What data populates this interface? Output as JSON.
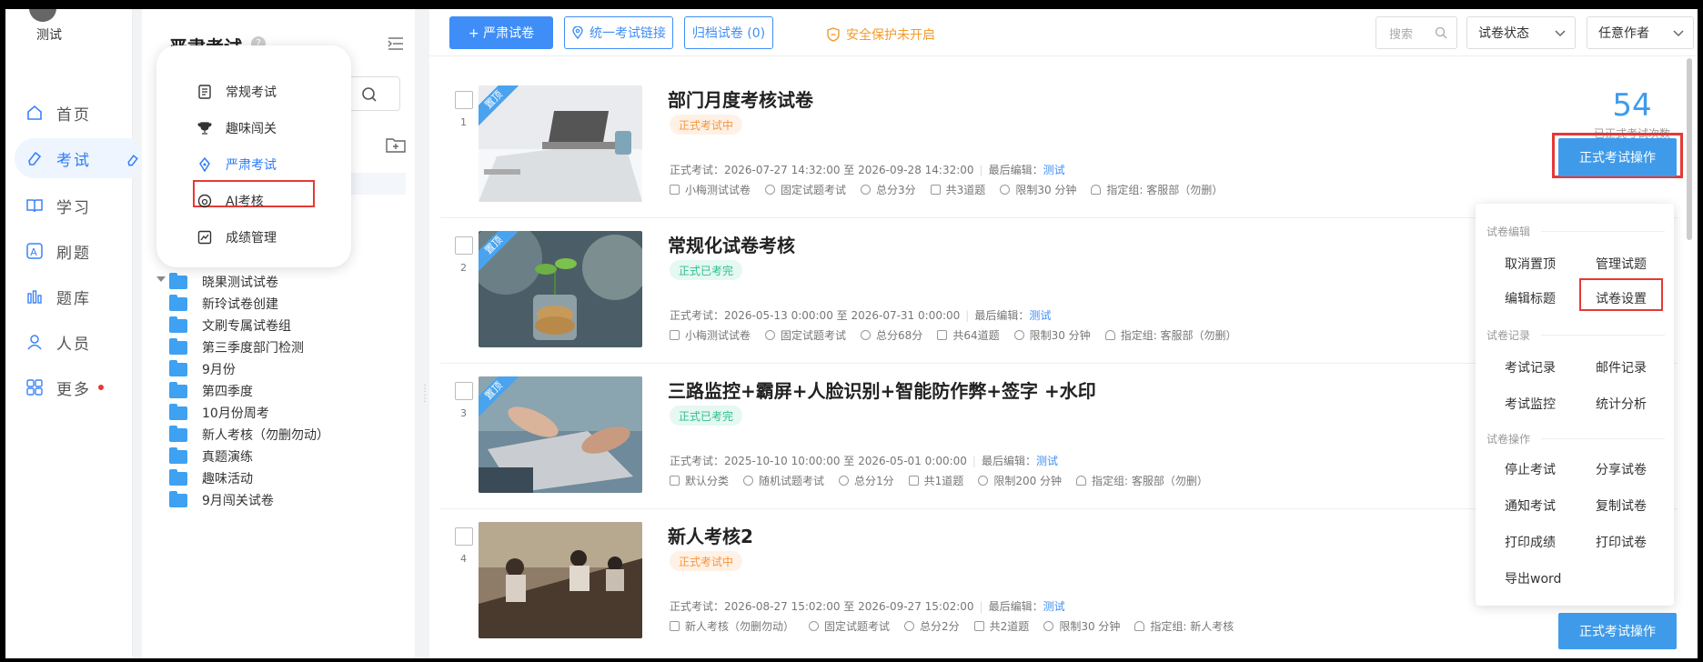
{
  "user": {
    "name": "测试"
  },
  "nav": {
    "items": [
      {
        "label": "首页",
        "icon": "home-icon"
      },
      {
        "label": "考试",
        "icon": "eraser-icon",
        "active": true
      },
      {
        "label": "学习",
        "icon": "book-icon"
      },
      {
        "label": "刷题",
        "icon": "letter-a-icon"
      },
      {
        "label": "题库",
        "icon": "bar-chart-icon"
      },
      {
        "label": "人员",
        "icon": "person-icon"
      },
      {
        "label": "更多",
        "icon": "grid-icon",
        "dot": true
      }
    ]
  },
  "tree": {
    "title": "严肃考试",
    "folders": [
      "晓果测试试卷",
      "新玲试卷创建",
      "文刷专属试卷组",
      "第三季度部门检测",
      "9月份",
      "第四季度",
      "10月份周考",
      "新人考核（勿删勿动）",
      "真题演练",
      "趣味活动",
      "9月闯关试卷"
    ]
  },
  "popmenu": {
    "items": [
      "常规考试",
      "趣味闯关",
      "严肃考试",
      "AI考核",
      "成绩管理"
    ],
    "active": "严肃考试"
  },
  "toolbar": {
    "new_label": "+ 严肃试卷",
    "link_label": "统一考试链接",
    "archive_label": "归档试卷 (0)",
    "security_label": "安全保护未开启",
    "search_placeholder": "搜索",
    "status_select": "试卷状态",
    "author_select": "任意作者"
  },
  "cards": [
    {
      "index": "1",
      "ribbon": "置顶",
      "title": "部门月度考核试卷",
      "status": "正式考试中",
      "status_type": "orange",
      "time_label": "正式考试：",
      "time_range": "2026-07-27 14:32:00 至 2026-09-28 14:32:00",
      "editor_label": "最后编辑：",
      "editor": "测试",
      "meta": [
        "小梅测试试卷",
        "固定试题考试",
        "总分3分",
        "共3道题",
        "限制30 分钟",
        "指定组: 客服部（勿删）"
      ],
      "count": "54",
      "count_label": "已正式考试次数",
      "op_label": "正式考试操作"
    },
    {
      "index": "2",
      "ribbon": "置顶",
      "title": "常规化试卷考核",
      "status": "正式已考完",
      "status_type": "green",
      "time_label": "正式考试：",
      "time_range": "2026-05-13 0:00:00 至 2026-07-31 0:00:00",
      "editor_label": "最后编辑：",
      "editor": "测试",
      "meta": [
        "小梅测试试卷",
        "固定试题考试",
        "总分68分",
        "共64道题",
        "限制30 分钟",
        "指定组: 客服部（勿删）"
      ]
    },
    {
      "index": "3",
      "ribbon": "置顶",
      "title": "三路监控+霸屏+人脸识别+智能防作弊+签字 +水印",
      "status": "正式已考完",
      "status_type": "green",
      "time_label": "正式考试：",
      "time_range": "2025-10-10 10:00:00 至 2026-05-01 0:00:00",
      "editor_label": "最后编辑：",
      "editor": "测试",
      "meta": [
        "默认分类",
        "随机试题考试",
        "总分1分",
        "共1道题",
        "限制200 分钟",
        "指定组: 客服部（勿删）"
      ]
    },
    {
      "index": "4",
      "title": "新人考核2",
      "status": "正式考试中",
      "status_type": "orange",
      "time_label": "正式考试：",
      "time_range": "2026-08-27 15:02:00 至 2026-09-27 15:02:00",
      "editor_label": "最后编辑：",
      "editor": "测试",
      "meta": [
        "新人考核（勿删勿动）",
        "固定试题考试",
        "总分2分",
        "共2道题",
        "限制30 分钟",
        "指定组: 新人考核"
      ],
      "op_label": "正式考试操作"
    }
  ],
  "dropdown": {
    "sections": [
      {
        "title": "试卷编辑",
        "items": [
          "取消置顶",
          "管理试题",
          "编辑标题",
          "试卷设置"
        ]
      },
      {
        "title": "试卷记录",
        "items": [
          "考试记录",
          "邮件记录",
          "考试监控",
          "统计分析"
        ]
      },
      {
        "title": "试卷操作",
        "items": [
          "停止考试",
          "分享试卷",
          "通知考试",
          "复制试卷",
          "打印成绩",
          "打印试卷",
          "导出word"
        ]
      }
    ],
    "highlighted": "试卷设置"
  },
  "colors": {
    "accent": "#3f8ef7",
    "highlight": "#e53935",
    "warning": "#f39a2c"
  }
}
